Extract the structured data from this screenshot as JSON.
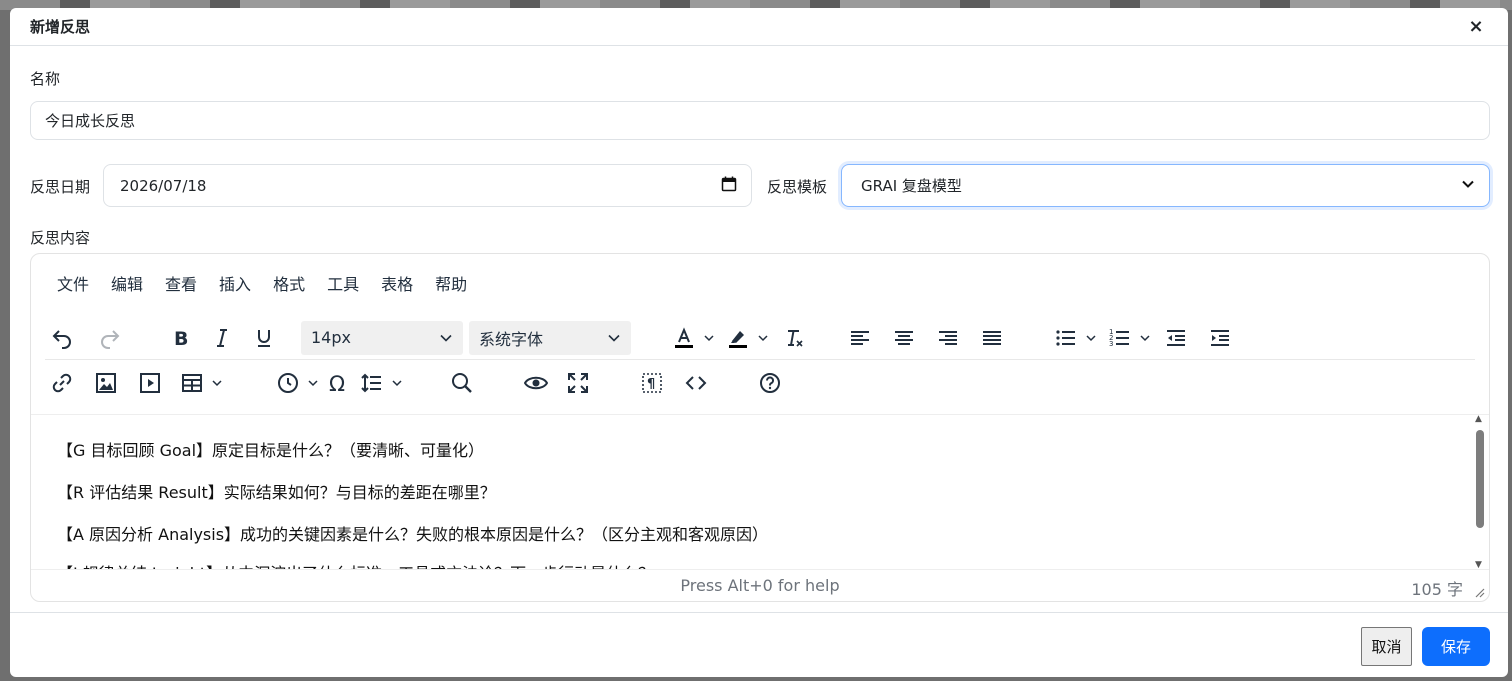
{
  "modal": {
    "title": "新增反思",
    "close_icon": "×"
  },
  "form": {
    "name_label": "名称",
    "name_value": "今日成长反思",
    "date_label": "反思日期",
    "date_value": "2026/07/18",
    "template_label": "反思模板",
    "template_value": "GRAI 复盘模型",
    "content_label": "反思内容"
  },
  "editor": {
    "menu": [
      "文件",
      "编辑",
      "查看",
      "插入",
      "格式",
      "工具",
      "表格",
      "帮助"
    ],
    "font_size": "14px",
    "font_family": "系统字体",
    "content_lines": [
      "【G 目标回顾 Goal】原定目标是什么？（要清晰、可量化）",
      "【R 评估结果 Result】实际结果如何？与目标的差距在哪里？",
      "【A 原因分析 Analysis】成功的关键因素是什么？失败的根本原因是什么？（区分主观和客观原因）",
      "【I 规律总结 Insight】从中沉淀出了什么标准、工具或方法论？下一步行动是什么？"
    ],
    "status_help": "Press Alt+0 for help",
    "word_count": "105 字"
  },
  "footer": {
    "cancel_label": "取消",
    "save_label": "保存"
  },
  "colors": {
    "primary": "#0d6efd",
    "focus_border": "#86b7fe"
  }
}
